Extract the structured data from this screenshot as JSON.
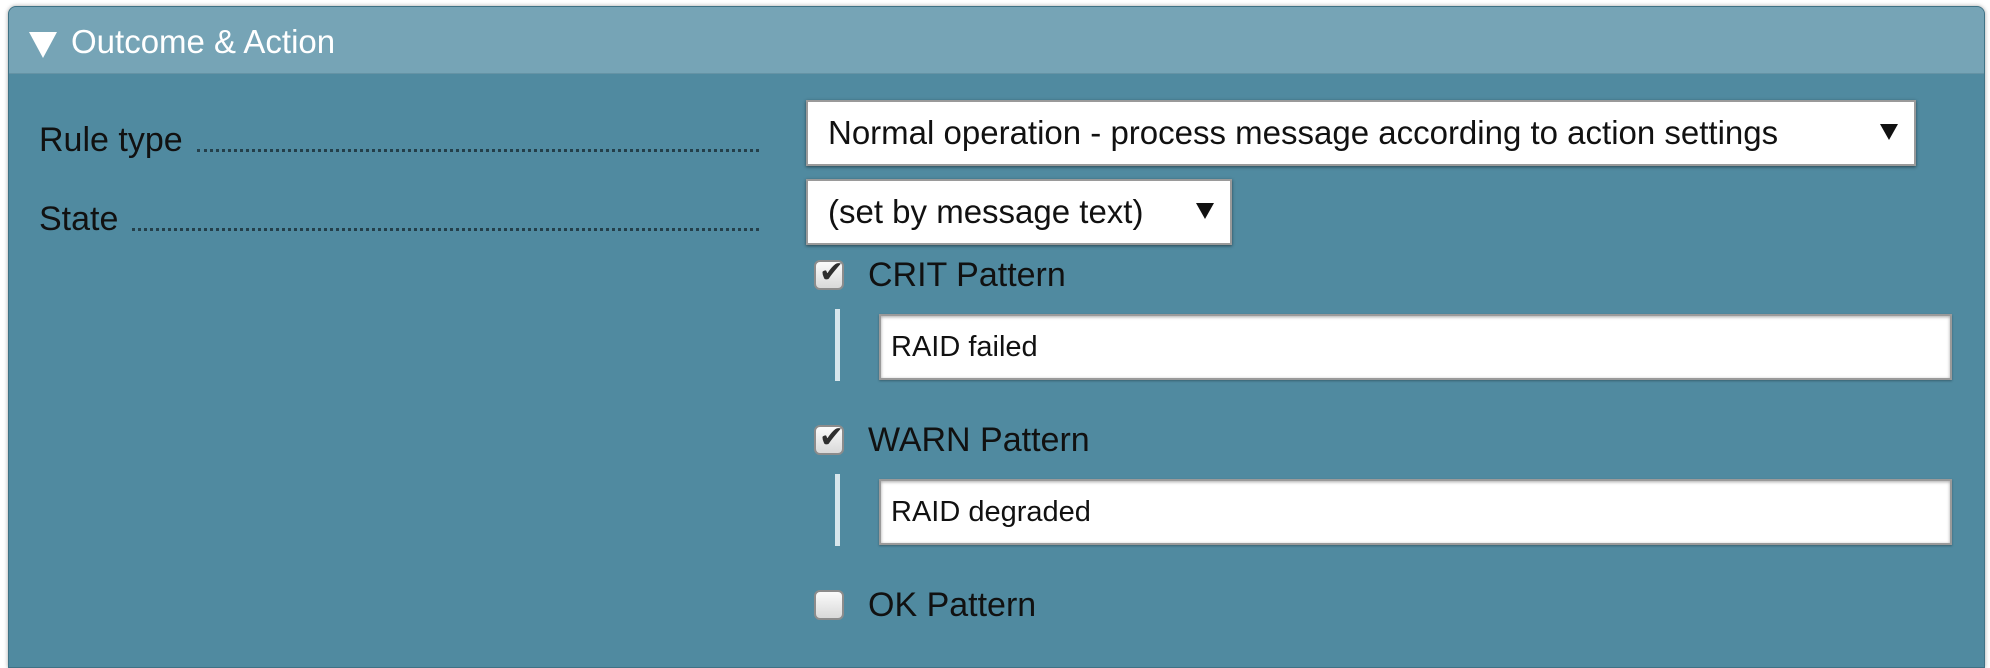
{
  "section": {
    "title": "Outcome & Action"
  },
  "rule_type": {
    "label": "Rule type",
    "value": "Normal operation - process message according to action settings"
  },
  "state": {
    "label": "State",
    "value": "(set by message text)"
  },
  "patterns": {
    "crit": {
      "label": "CRIT Pattern",
      "checked": true,
      "value": "RAID failed"
    },
    "warn": {
      "label": "WARN Pattern",
      "checked": true,
      "value": "RAID degraded"
    },
    "ok": {
      "label": "OK Pattern",
      "checked": false
    }
  },
  "icons": {
    "collapse": "triangle-down-icon",
    "dropdown": "caret-down-icon",
    "check": "checkmark-icon"
  },
  "colors": {
    "panel_bg": "#508aa0",
    "header_bg": "#76a4b6"
  }
}
